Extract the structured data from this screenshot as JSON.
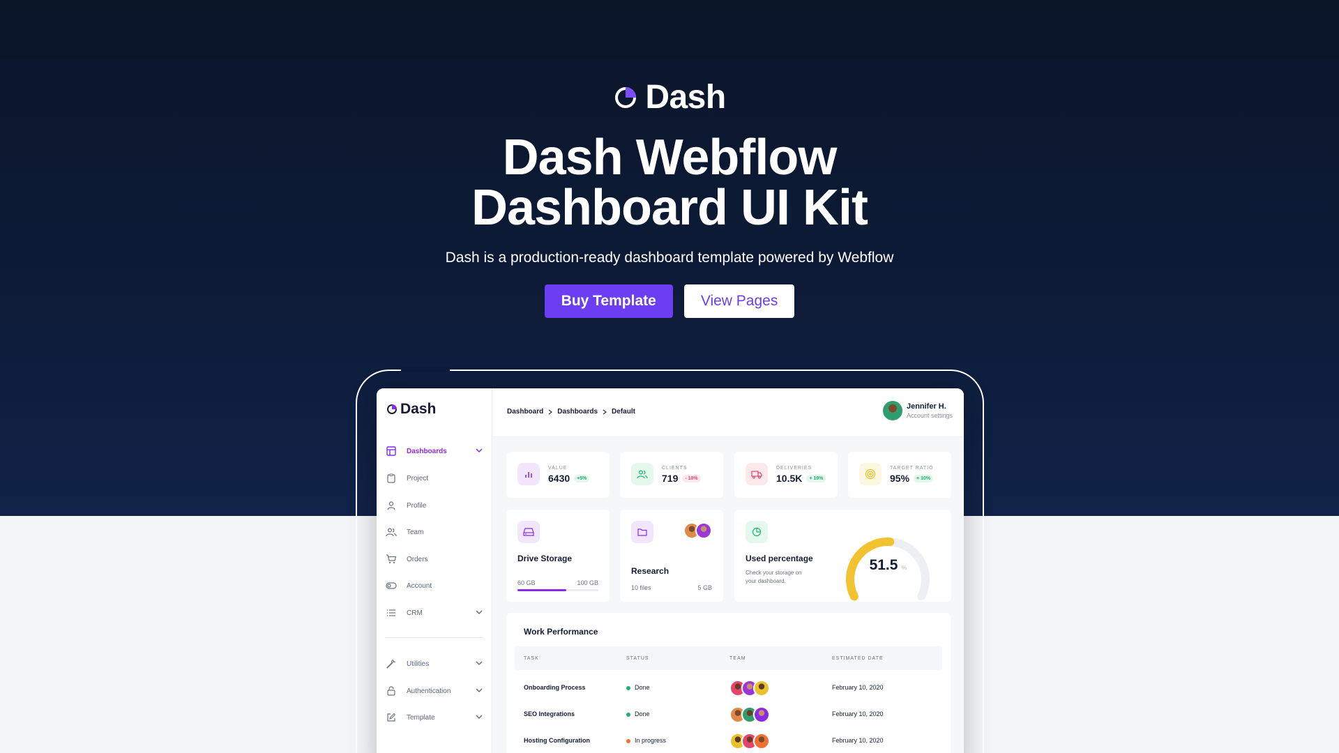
{
  "hero": {
    "brand": "Dash",
    "headline_line1": "Dash Webflow",
    "headline_line2": "Dashboard UI Kit",
    "subhead": "Dash is a production-ready dashboard template powered by Webflow",
    "primary_cta": "Buy Template",
    "secondary_cta": "View Pages"
  },
  "app": {
    "logo": "Dash",
    "sidebar": {
      "items": [
        {
          "label": "Dashboards",
          "icon": "layout-icon",
          "active": true,
          "expandable": true
        },
        {
          "label": "Project",
          "icon": "clipboard-icon"
        },
        {
          "label": "Profile",
          "icon": "user-icon"
        },
        {
          "label": "Team",
          "icon": "users-icon"
        },
        {
          "label": "Orders",
          "icon": "cart-icon"
        },
        {
          "label": "Account",
          "icon": "toggle-icon"
        },
        {
          "label": "CRM",
          "icon": "list-icon",
          "expandable": true
        },
        {
          "label": "Utilities",
          "icon": "wrench-icon",
          "expandable": true
        },
        {
          "label": "Authentication",
          "icon": "lock-icon",
          "expandable": true
        },
        {
          "label": "Template",
          "icon": "edit-icon",
          "expandable": true
        }
      ]
    },
    "breadcrumb": [
      "Dashboard",
      "Dashboards",
      "Default"
    ],
    "user": {
      "name": "Jennifer H.",
      "subtitle": "Account settings"
    },
    "stats": [
      {
        "label": "VALUE",
        "value": "6430",
        "badge": "+5%",
        "trend": "up",
        "icon": "bar-chart-icon",
        "color": "#8a2be2",
        "bg": "#f1e6fc"
      },
      {
        "label": "CLIENTS",
        "value": "719",
        "badge": "- 10%",
        "trend": "down",
        "icon": "users-icon",
        "color": "#20b26b",
        "bg": "#e4f8ee"
      },
      {
        "label": "DELIVERIES",
        "value": "10.5K",
        "badge": "+ 19%",
        "trend": "up",
        "icon": "truck-icon",
        "color": "#e2466b",
        "bg": "#fde8ec"
      },
      {
        "label": "TARGET RATIO",
        "value": "95%",
        "badge": "+ 10%",
        "trend": "up",
        "icon": "target-icon",
        "color": "#e9c12c",
        "bg": "#fdf7e0"
      }
    ],
    "drive": {
      "title": "Drive Storage",
      "used": "60 GB",
      "total": "100 GB",
      "progress": 0.6
    },
    "research": {
      "title": "Research",
      "files": "10 files",
      "size": "5 GB"
    },
    "usage": {
      "title": "Used percentage",
      "desc_line1": "Check your storage on",
      "desc_line2": "your dashboard.",
      "value": "51.5",
      "unit": "%",
      "percent": 51.5
    },
    "work": {
      "title": "Work Performance",
      "columns": [
        "TASK",
        "STATUS",
        "TEAM",
        "ESTIMATED DATE"
      ],
      "rows": [
        {
          "task": "Onboarding Process",
          "status": "Done",
          "status_color": "#20b26b",
          "date": "February 10, 2020"
        },
        {
          "task": "SEO Integrations",
          "status": "Done",
          "status_color": "#20b26b",
          "date": "February 10, 2020"
        },
        {
          "task": "Hosting Configuration",
          "status": "In progress",
          "status_color": "#f07032",
          "date": "February 10, 2020"
        }
      ]
    }
  },
  "colors": {
    "accent": "#6c3df2",
    "purple": "#8a2be2",
    "hero_bg": "#0d1b38"
  }
}
